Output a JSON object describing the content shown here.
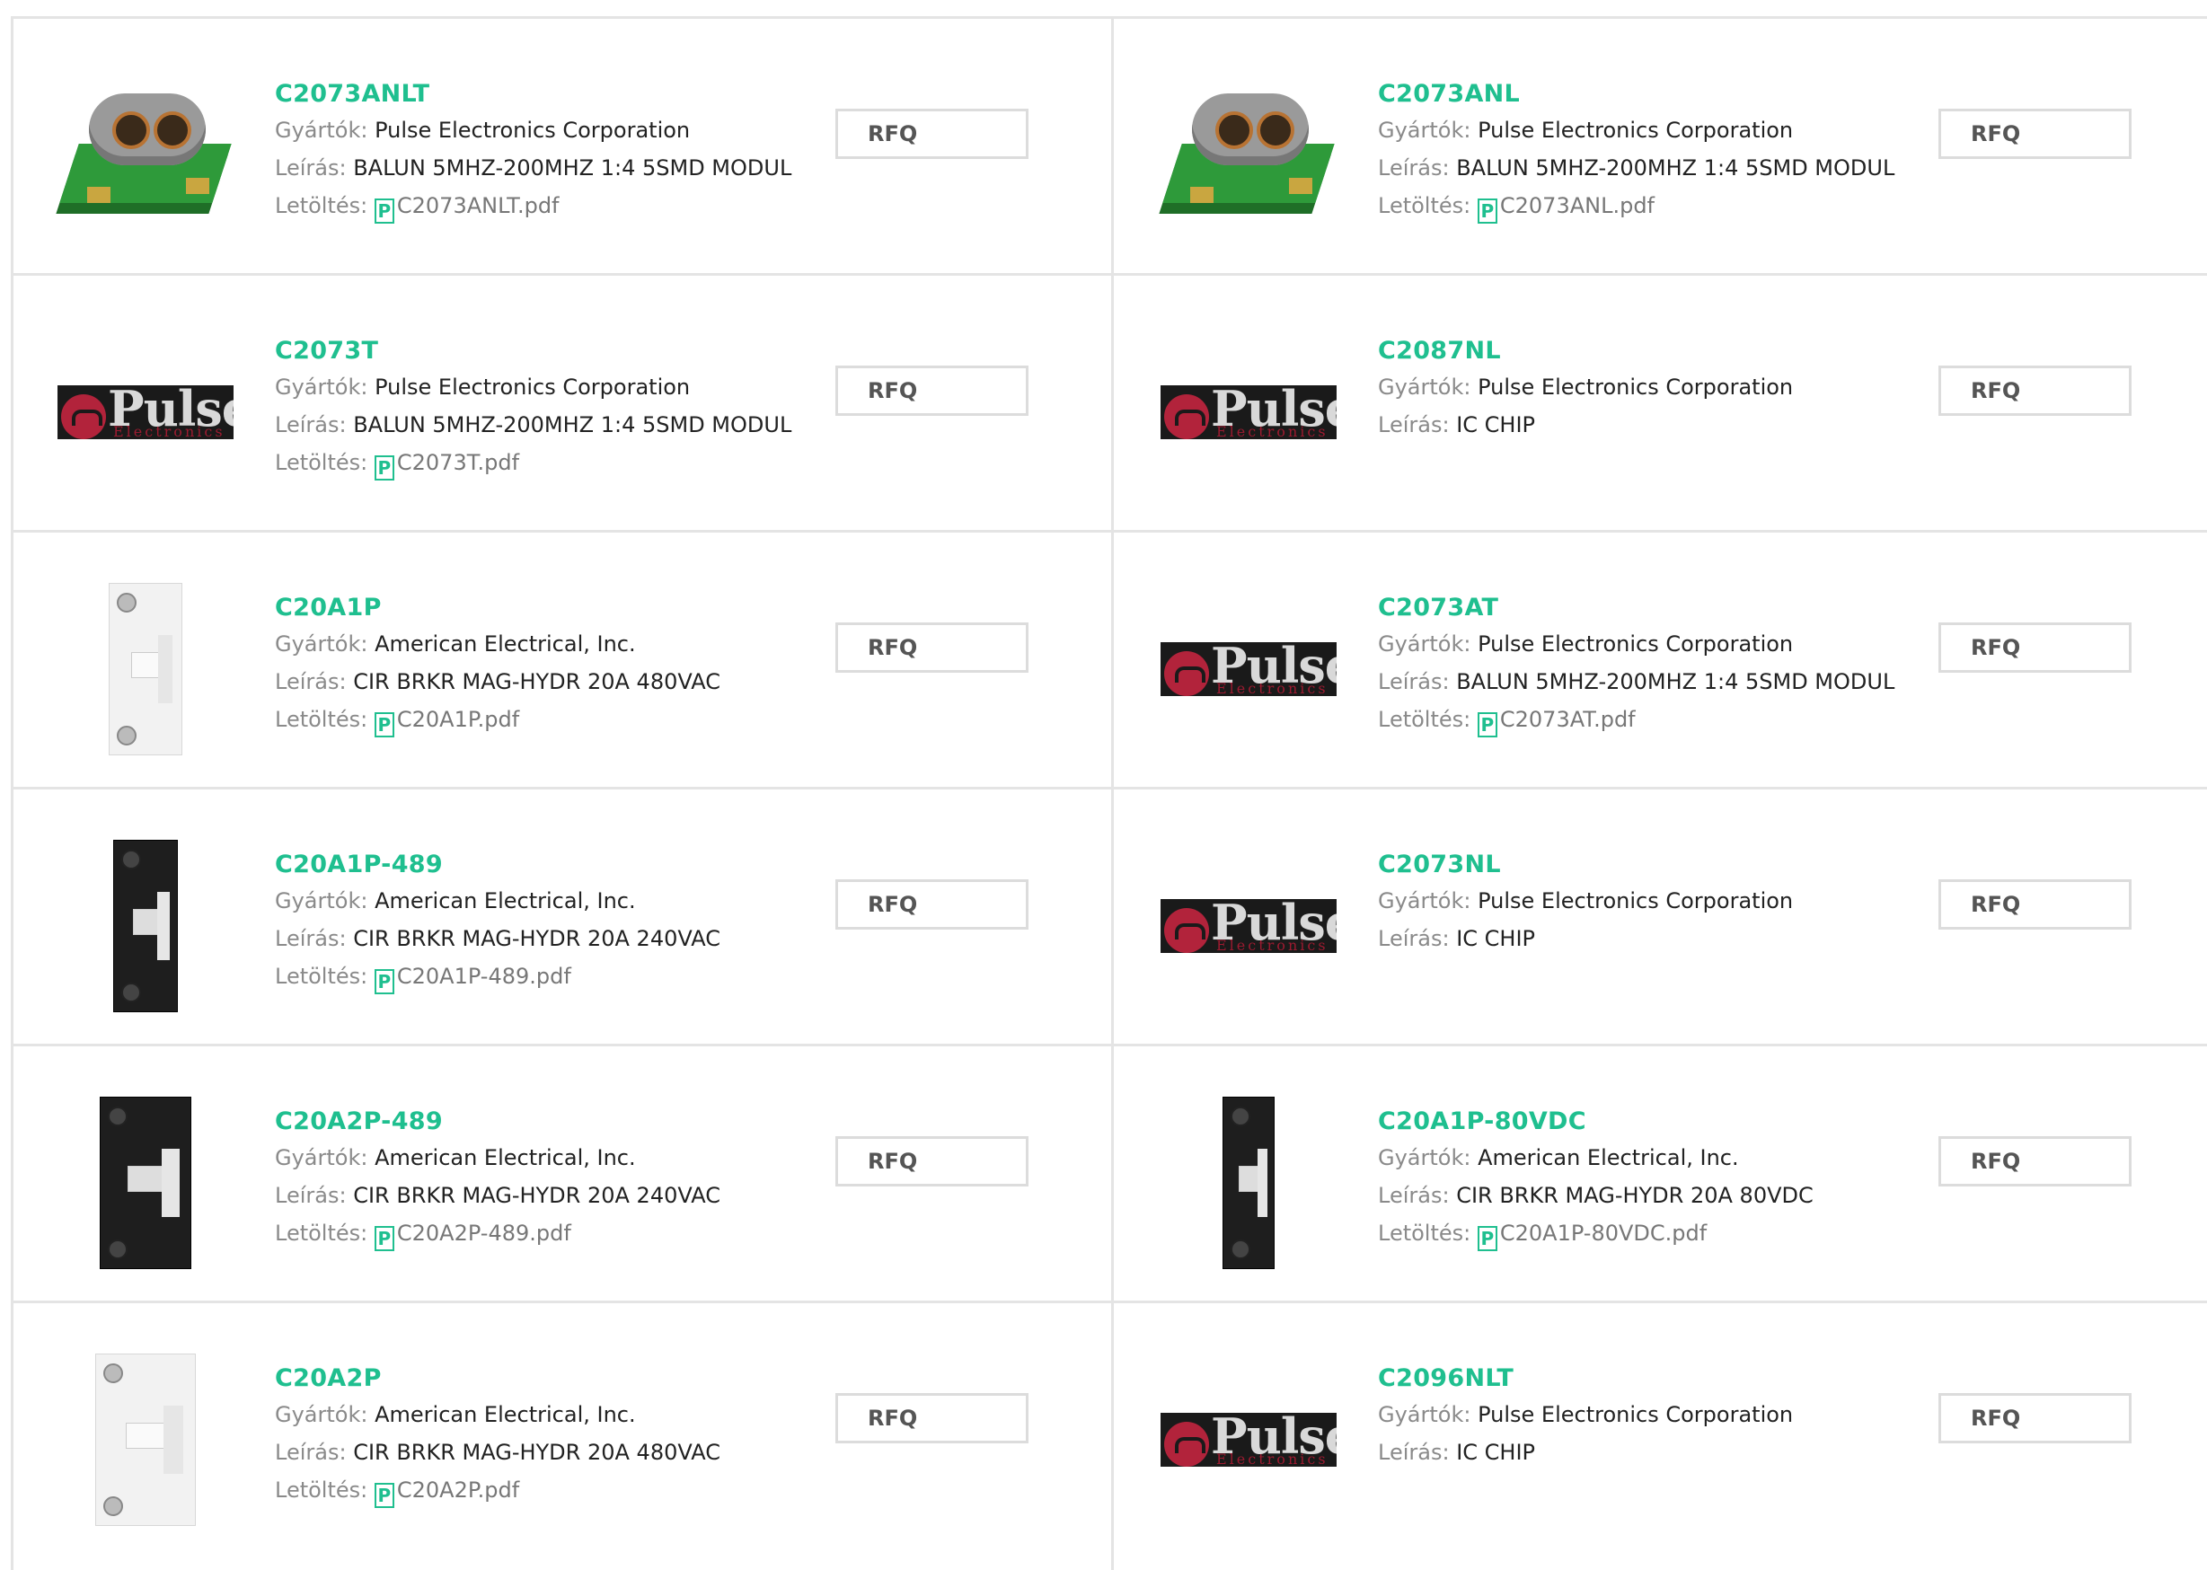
{
  "labels": {
    "manufacturer": "Gyártók:",
    "description": "Leírás:",
    "download": "Letöltés:",
    "rfq": "RFQ",
    "pdf_glyph": "P"
  },
  "colors": {
    "accent": "#1fbf8f",
    "label_gray": "#8a8a8a",
    "divider": "#e4e4e4"
  },
  "products": [
    {
      "name": "C2073ANLT",
      "manufacturer": "Pulse Electronics Corporation",
      "description": "BALUN 5MHZ-200MHZ 1:4 5SMD MODUL",
      "file": "C2073ANLT.pdf",
      "image": "balun-transformer"
    },
    {
      "name": "C2073ANL",
      "manufacturer": "Pulse Electronics Corporation",
      "description": "BALUN 5MHZ-200MHZ 1:4 5SMD MODUL",
      "file": "C2073ANL.pdf",
      "image": "balun-transformer"
    },
    {
      "name": "C2073T",
      "manufacturer": "Pulse Electronics Corporation",
      "description": "BALUN 5MHZ-200MHZ 1:4 5SMD MODUL",
      "file": "C2073T.pdf",
      "image": "pulse-logo",
      "logo_word": "Pulse",
      "logo_sub": "Electronics"
    },
    {
      "name": "C2087NL",
      "manufacturer": "Pulse Electronics Corporation",
      "description": "IC CHIP",
      "file": "",
      "image": "pulse-logo",
      "logo_word": "Pulse",
      "logo_sub": "Electronics"
    },
    {
      "name": "C20A1P",
      "manufacturer": "American Electrical, Inc.",
      "description": "CIR BRKR MAG-HYDR 20A 480VAC",
      "file": "C20A1P.pdf",
      "image": "breaker-white-1p"
    },
    {
      "name": "C2073AT",
      "manufacturer": "Pulse Electronics Corporation",
      "description": "BALUN 5MHZ-200MHZ 1:4 5SMD MODUL",
      "file": "C2073AT.pdf",
      "image": "pulse-logo",
      "logo_word": "Pulse",
      "logo_sub": "Electronics"
    },
    {
      "name": "C20A1P-489",
      "manufacturer": "American Electrical, Inc.",
      "description": "CIR BRKR MAG-HYDR 20A 240VAC",
      "file": "C20A1P-489.pdf",
      "image": "breaker-black-1p"
    },
    {
      "name": "C2073NL",
      "manufacturer": "Pulse Electronics Corporation",
      "description": "IC CHIP",
      "file": "",
      "image": "pulse-logo",
      "logo_word": "Pulse",
      "logo_sub": "Electronics"
    },
    {
      "name": "C20A2P-489",
      "manufacturer": "American Electrical, Inc.",
      "description": "CIR BRKR MAG-HYDR 20A 240VAC",
      "file": "C20A2P-489.pdf",
      "image": "breaker-black-2p"
    },
    {
      "name": "C20A1P-80VDC",
      "manufacturer": "American Electrical, Inc.",
      "description": "CIR BRKR MAG-HYDR 20A 80VDC",
      "file": "C20A1P-80VDC.pdf",
      "image": "breaker-black-1p-slim"
    },
    {
      "name": "C20A2P",
      "manufacturer": "American Electrical, Inc.",
      "description": "CIR BRKR MAG-HYDR 20A 480VAC",
      "file": "C20A2P.pdf",
      "image": "breaker-white-2p"
    },
    {
      "name": "C2096NLT",
      "manufacturer": "Pulse Electronics Corporation",
      "description": "IC CHIP",
      "file": "",
      "image": "pulse-logo",
      "logo_word": "Pulse",
      "logo_sub": "Electronics"
    }
  ]
}
